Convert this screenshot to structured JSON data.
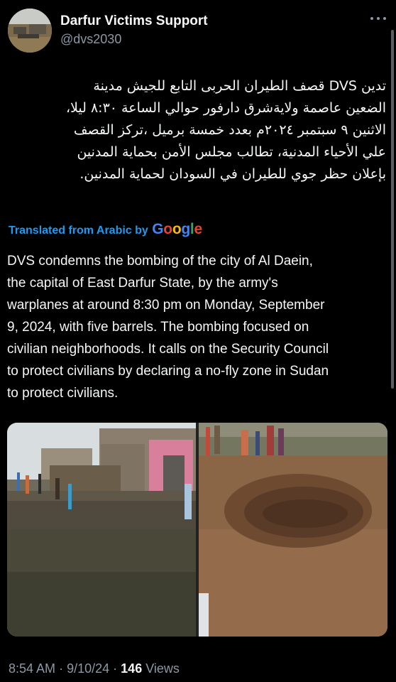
{
  "tweet": {
    "author": {
      "display_name": "Darfur Victims Support",
      "handle": "@dvs2030"
    },
    "arabic_text": "تدين DVS قصف الطيران الحربى  التابع للجيش مدينة\nالضعين عاصمة ولاية‌شرق دارفور حوالي الساعة ٨:٣٠ ليلا،\nالاثنين ٩ سبتمبر ٢٠٢٤م بعدد خمسة  برميل ،تركز القصف\nعلي الأحياء المدنية، تطالب مجلس الأمن بحماية المدنين\nبإعلان حظر  جوي  للطيران في السودان لحماية المدنين.",
    "translation": {
      "label": "Translated from Arabic by",
      "provider": "Google"
    },
    "english_text": "DVS condemns the bombing of the city of Al Daein,\nthe capital of East Darfur State, by the army's\nwarplanes at around 8:30 pm on Monday, September\n9, 2024, with five barrels. The bombing focused on\ncivilian neighborhoods. It calls on the Security Council\nto protect civilians by declaring a no-fly zone in Sudan\nto protect civilians.",
    "meta": {
      "time": "8:54 AM",
      "separator": "·",
      "date": "9/10/24",
      "views_count": "146",
      "views_label": "Views"
    }
  },
  "icons": {
    "more": "more-horizontal-icon"
  },
  "colors": {
    "background": "#000000",
    "text_primary": "#f5f6f7",
    "text_secondary": "#8b98a5",
    "link_blue": "#1d9bf0",
    "google_blue": "#4285f4",
    "google_red": "#ea4335",
    "google_yellow": "#fbbc05",
    "google_green": "#34a853"
  }
}
